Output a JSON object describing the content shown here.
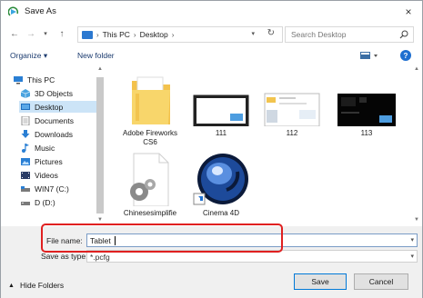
{
  "window": {
    "title": "Save As",
    "close_glyph": "×"
  },
  "nav": {
    "back_glyph": "←",
    "forward_glyph": "→",
    "recent_glyph": "▾",
    "up_glyph": "↑",
    "breadcrumbs": [
      "This PC",
      "Desktop"
    ],
    "crumb_separator": "›",
    "refresh_glyph": "↻",
    "dropdown_glyph": "▾",
    "search_placeholder": "Search Desktop"
  },
  "command_bar": {
    "organize": "Organize ▾",
    "new_folder": "New folder",
    "help": "?"
  },
  "sidebar": {
    "items": [
      {
        "label": "This PC",
        "icon": "computer-icon"
      },
      {
        "label": "3D Objects",
        "icon": "3d-objects-icon"
      },
      {
        "label": "Desktop",
        "icon": "desktop-icon",
        "selected": true
      },
      {
        "label": "Documents",
        "icon": "documents-icon"
      },
      {
        "label": "Downloads",
        "icon": "downloads-icon"
      },
      {
        "label": "Music",
        "icon": "music-icon"
      },
      {
        "label": "Pictures",
        "icon": "pictures-icon"
      },
      {
        "label": "Videos",
        "icon": "videos-icon"
      },
      {
        "label": "WIN7 (C:)",
        "icon": "drive-icon"
      },
      {
        "label": "D (D:)",
        "icon": "drive-icon"
      }
    ]
  },
  "files": [
    {
      "label": "Adobe Fireworks CS6",
      "icon": "folder-icon"
    },
    {
      "label": "111",
      "icon": "image-thumbnail-icon"
    },
    {
      "label": "112",
      "icon": "image-thumbnail-icon"
    },
    {
      "label": "113",
      "icon": "image-thumbnail-icon"
    },
    {
      "label": "Chinesesimplifie",
      "icon": "settings-file-icon"
    },
    {
      "label": "Cinema 4D",
      "icon": "cinema4d-icon"
    }
  ],
  "bottom": {
    "file_name_label": "File name:",
    "file_name_value": "Tablet",
    "save_type_label": "Save as type:",
    "save_type_value": "*.pcfg",
    "hide_folders": "Hide Folders",
    "save_button": "Save",
    "cancel_button": "Cancel"
  },
  "colors": {
    "accent": "#0078d7",
    "highlight_box": "#e02020",
    "selection": "#cce4f7"
  }
}
